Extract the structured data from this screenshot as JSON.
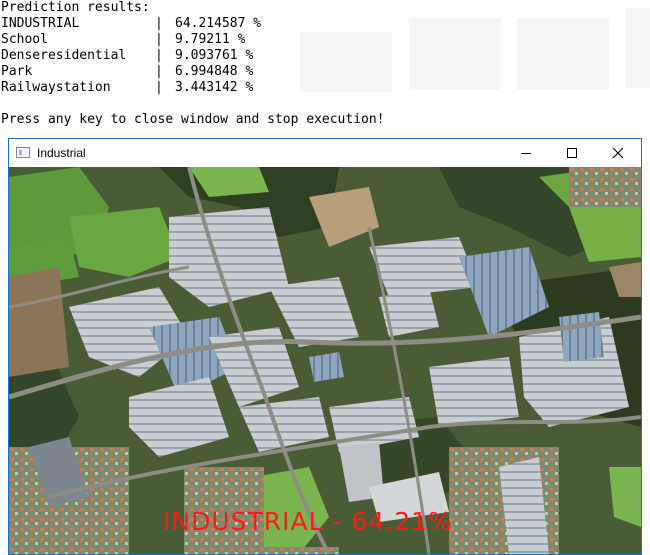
{
  "console": {
    "header": "Prediction results:",
    "results": [
      {
        "name": "INDUSTRIAL",
        "sep": "|",
        "value": "64.214587 %"
      },
      {
        "name": "School",
        "sep": "|",
        "value": "9.79211 %"
      },
      {
        "name": "Denseresidential",
        "sep": "|",
        "value": "9.093761 %"
      },
      {
        "name": "Park",
        "sep": "|",
        "value": "6.994848 %"
      },
      {
        "name": "Railwaystation",
        "sep": "|",
        "value": "3.443142 %"
      }
    ],
    "footer": "Press any key to close window and stop execution!"
  },
  "window": {
    "title": "Industrial",
    "overlay_text": "INDUSTRIAL - 64.21%",
    "overlay_color": "#ff1a1a",
    "border_color": "#1a73c5"
  },
  "icons": {
    "app": "app-icon",
    "minimize": "minimize-icon",
    "maximize": "maximize-icon",
    "close": "close-icon"
  }
}
